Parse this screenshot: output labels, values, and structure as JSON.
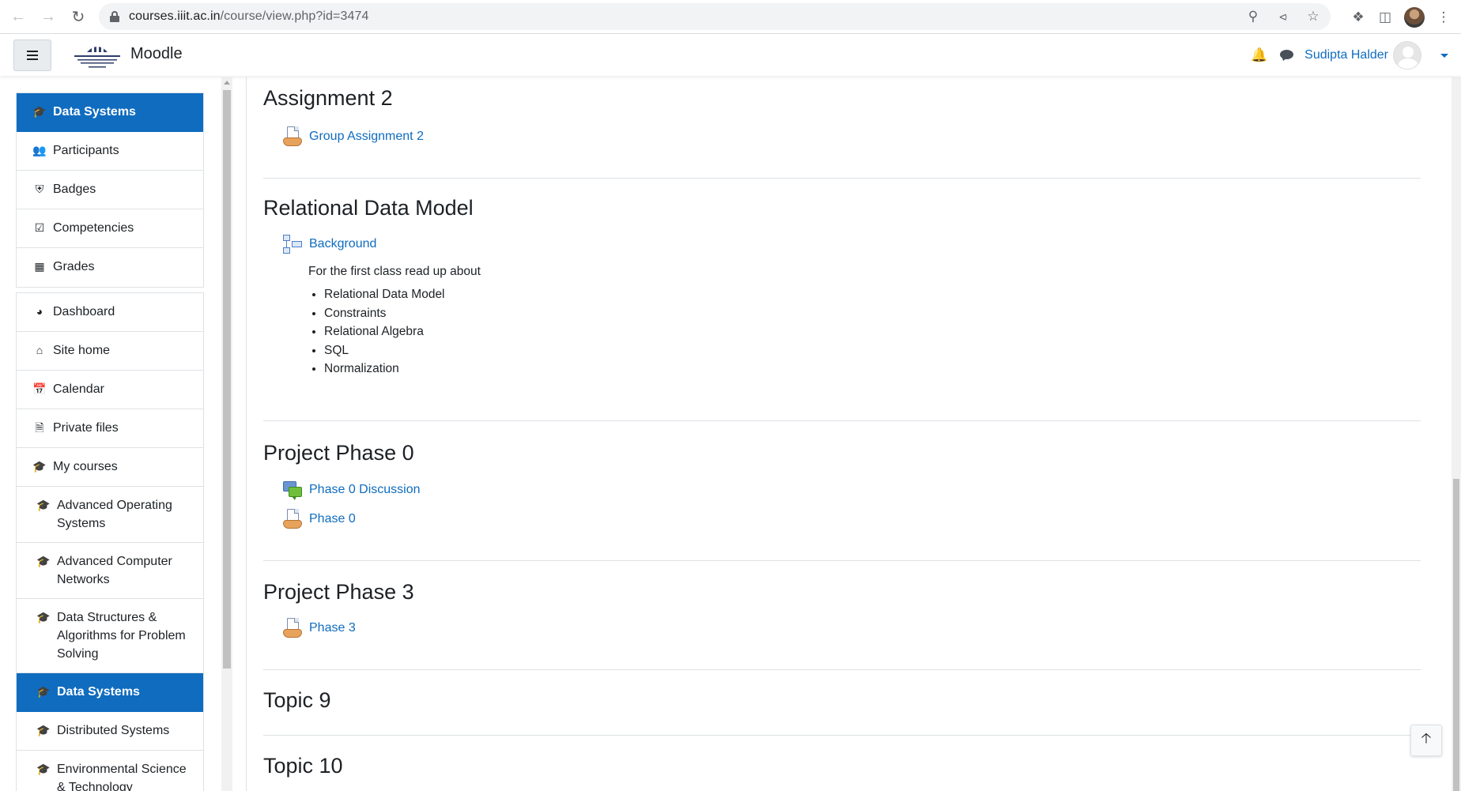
{
  "browser": {
    "url_host": "courses.iiit.ac.in",
    "url_path": "/course/view.php?id=3474"
  },
  "navbar": {
    "brand": "Moodle",
    "user_name": "Sudipta Halder"
  },
  "sidebar": {
    "course_group": [
      {
        "label": "Data Systems",
        "icon": "graduation-cap-icon",
        "active": true
      },
      {
        "label": "Participants",
        "icon": "users-icon"
      },
      {
        "label": "Badges",
        "icon": "shield-icon"
      },
      {
        "label": "Competencies",
        "icon": "check-square-icon"
      },
      {
        "label": "Grades",
        "icon": "table-icon"
      }
    ],
    "site_group": [
      {
        "label": "Dashboard",
        "icon": "dashboard-icon"
      },
      {
        "label": "Site home",
        "icon": "home-icon"
      },
      {
        "label": "Calendar",
        "icon": "calendar-icon"
      },
      {
        "label": "Private files",
        "icon": "file-icon"
      },
      {
        "label": "My courses",
        "icon": "graduation-cap-icon"
      },
      {
        "label": "Advanced Operating Systems",
        "icon": "graduation-cap-icon"
      },
      {
        "label": "Advanced Computer Networks",
        "icon": "graduation-cap-icon"
      },
      {
        "label": "Data Structures & Algorithms for Problem Solving",
        "icon": "graduation-cap-icon"
      },
      {
        "label": "Data Systems",
        "icon": "graduation-cap-icon",
        "active": true
      },
      {
        "label": "Distributed Systems",
        "icon": "graduation-cap-icon"
      },
      {
        "label": "Environmental Science & Technology",
        "icon": "graduation-cap-icon"
      }
    ]
  },
  "sections": [
    {
      "title": "Assignment 2",
      "activities": [
        {
          "label": "Group Assignment 2",
          "icon": "assignment-icon"
        }
      ]
    },
    {
      "title": "Relational Data Model",
      "activities": [
        {
          "label": "Background",
          "icon": "book-icon"
        }
      ],
      "summary_intro": "For the first class read up about",
      "summary_items": [
        "Relational Data Model",
        "Constraints",
        "Relational Algebra",
        "SQL",
        "Normalization"
      ]
    },
    {
      "title": "Project Phase 0",
      "activities": [
        {
          "label": "Phase 0 Discussion",
          "icon": "forum-icon"
        },
        {
          "label": "Phase 0",
          "icon": "assignment-icon"
        }
      ]
    },
    {
      "title": "Project Phase 3",
      "activities": [
        {
          "label": "Phase 3",
          "icon": "assignment-icon"
        }
      ]
    },
    {
      "title": "Topic 9",
      "activities": []
    },
    {
      "title": "Topic 10",
      "activities": []
    }
  ],
  "colors": {
    "primary": "#0f6cbf",
    "text": "#1d2125",
    "border": "#dee2e6"
  }
}
